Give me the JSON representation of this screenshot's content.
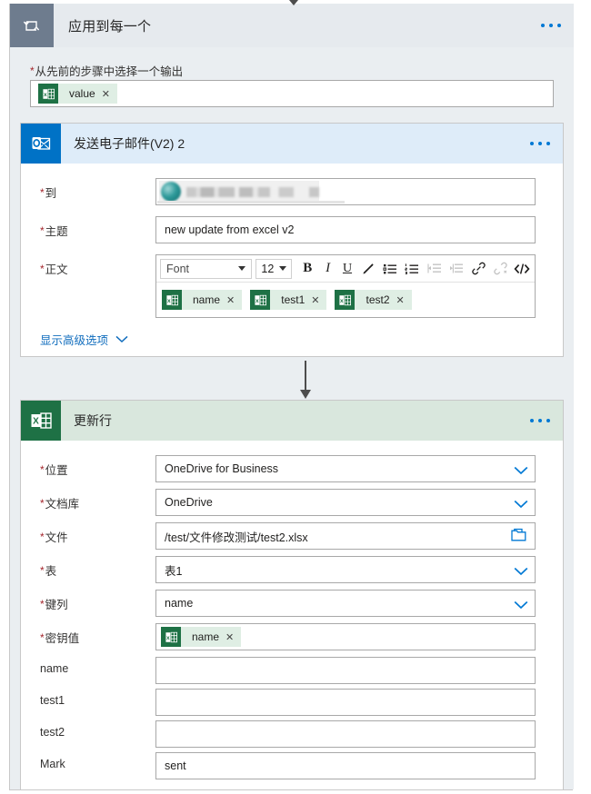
{
  "scope": {
    "title": "应用到每一个",
    "icon": "loop-icon",
    "menu_icon": "ellipsis-icon",
    "output_field": {
      "label": "从先前的步骤中选择一个输出",
      "required": true,
      "token": {
        "text": "value",
        "icon": "excel-icon",
        "remove": "✕"
      }
    }
  },
  "mail_card": {
    "title": "发送电子邮件(V2) 2",
    "icon": "outlook-icon",
    "menu_icon": "ellipsis-icon",
    "fields": {
      "to": {
        "label": "到",
        "required": true,
        "value_redacted": true
      },
      "subject": {
        "label": "主题",
        "required": true,
        "value": "new update from excel v2"
      },
      "body": {
        "label": "正文",
        "required": true
      }
    },
    "toolbar": {
      "font_label": "Font",
      "size_label": "12",
      "bold": "B",
      "italic": "I",
      "underline": "U",
      "text_color_icon": "pen-icon",
      "bulleted_list_icon": "bulleted-list-icon",
      "numbered_list_icon": "numbered-list-icon",
      "decrease_indent_icon": "decrease-indent-icon",
      "increase_indent_icon": "increase-indent-icon",
      "link_icon": "link-icon",
      "unlink_icon": "unlink-icon",
      "code_view_icon": "code-view-icon"
    },
    "body_tokens": [
      {
        "text": "name",
        "icon": "excel-icon",
        "remove": "✕"
      },
      {
        "text": "test1",
        "icon": "excel-icon",
        "remove": "✕"
      },
      {
        "text": "test2",
        "icon": "excel-icon",
        "remove": "✕"
      }
    ],
    "advanced_link": {
      "label": "显示高级选项",
      "icon": "chevron-down-icon"
    }
  },
  "excel_card": {
    "title": "更新行",
    "icon": "excel-icon",
    "menu_icon": "ellipsis-icon",
    "rows": [
      {
        "label": "位置",
        "required": true,
        "value": "OneDrive for Business",
        "control": "dropdown"
      },
      {
        "label": "文档库",
        "required": true,
        "value": "OneDrive",
        "control": "dropdown"
      },
      {
        "label": "文件",
        "required": true,
        "value": "/test/文件修改测试/test2.xlsx",
        "control": "file-picker"
      },
      {
        "label": "表",
        "required": true,
        "value": "表1",
        "control": "dropdown"
      },
      {
        "label": "键列",
        "required": true,
        "value": "name",
        "control": "dropdown"
      },
      {
        "label": "密钥值",
        "required": true,
        "value": "",
        "control": "token",
        "token": {
          "text": "name",
          "icon": "excel-icon",
          "remove": "✕"
        }
      },
      {
        "label": "name",
        "required": false,
        "value": "",
        "control": "text"
      },
      {
        "label": "test1",
        "required": false,
        "value": "",
        "control": "text"
      },
      {
        "label": "test2",
        "required": false,
        "value": "",
        "control": "text"
      },
      {
        "label": "Mark",
        "required": false,
        "value": "sent",
        "control": "text"
      }
    ]
  },
  "colors": {
    "outlook_blue": "#0072c6",
    "outlook_header": "#deecf9",
    "excel_green": "#1e7145",
    "excel_header": "#d9e7dd",
    "scope_gray": "#6e7c8e",
    "scope_header": "#e6eaee",
    "accent": "#0078d4",
    "required_red": "#a4262c",
    "link_blue": "#0f6cbd",
    "token_bg": "#dfeee4"
  }
}
